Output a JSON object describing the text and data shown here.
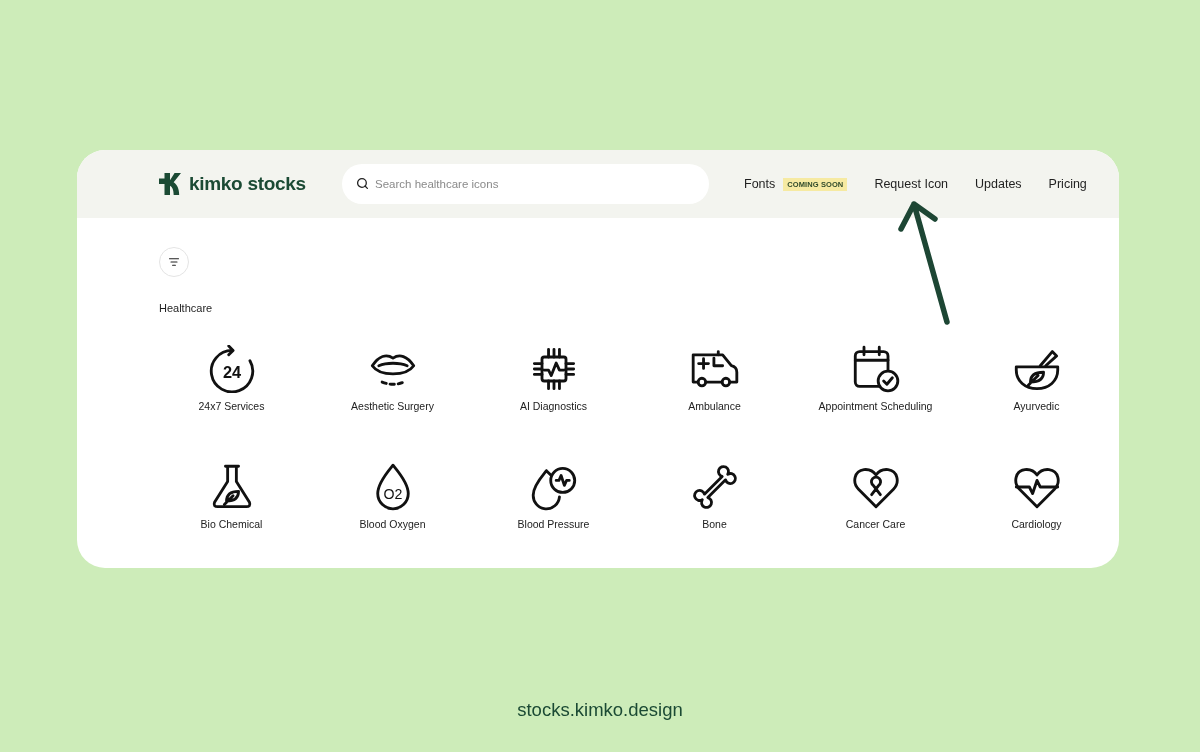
{
  "logo": {
    "text": "kimko stocks"
  },
  "search": {
    "placeholder": "Search healthcare icons"
  },
  "nav": [
    {
      "label": "Fonts",
      "badge": "COMING SOON"
    },
    {
      "label": "Request Icon"
    },
    {
      "label": "Updates"
    },
    {
      "label": "Pricing"
    }
  ],
  "section": {
    "title": "Healthcare",
    "icons": [
      {
        "label": "24x7 Services",
        "icon_text": "24"
      },
      {
        "label": "Aesthetic Surgery"
      },
      {
        "label": "AI Diagnostics"
      },
      {
        "label": "Ambulance"
      },
      {
        "label": "Appointment Scheduling"
      },
      {
        "label": "Ayurvedic"
      },
      {
        "label": "Bio Chemical"
      },
      {
        "label": "Blood Oxygen",
        "icon_text": "O2"
      },
      {
        "label": "Blood Pressure"
      },
      {
        "label": "Bone"
      },
      {
        "label": "Cancer Care"
      },
      {
        "label": "Cardiology"
      }
    ]
  },
  "footer": {
    "url": "stocks.kimko.design"
  }
}
